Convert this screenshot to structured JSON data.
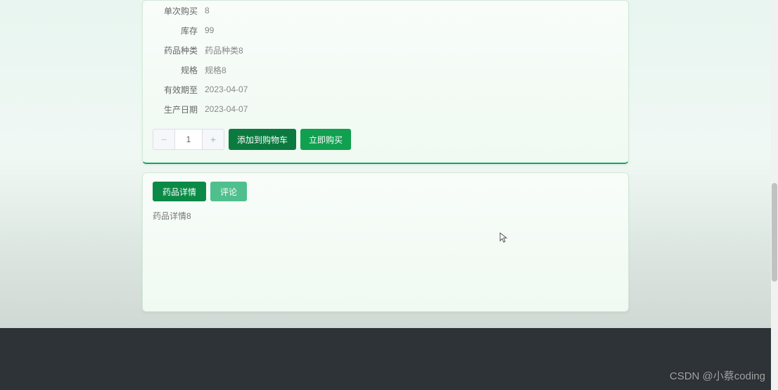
{
  "details": {
    "rows": [
      {
        "label": "单次购买",
        "value": "8"
      },
      {
        "label": "库存",
        "value": "99"
      },
      {
        "label": "药品种类",
        "value": "药品种类8"
      },
      {
        "label": "规格",
        "value": "规格8"
      },
      {
        "label": "有效期至",
        "value": "2023-04-07"
      },
      {
        "label": "生产日期",
        "value": "2023-04-07"
      }
    ]
  },
  "purchase": {
    "quantity": "1",
    "add_to_cart_label": "添加到购物车",
    "buy_now_label": "立即购买"
  },
  "tabs": {
    "detail_label": "药品详情",
    "review_label": "评论"
  },
  "tab_content": {
    "detail_text": "药品详情8"
  },
  "watermark": "CSDN @小蔡coding"
}
